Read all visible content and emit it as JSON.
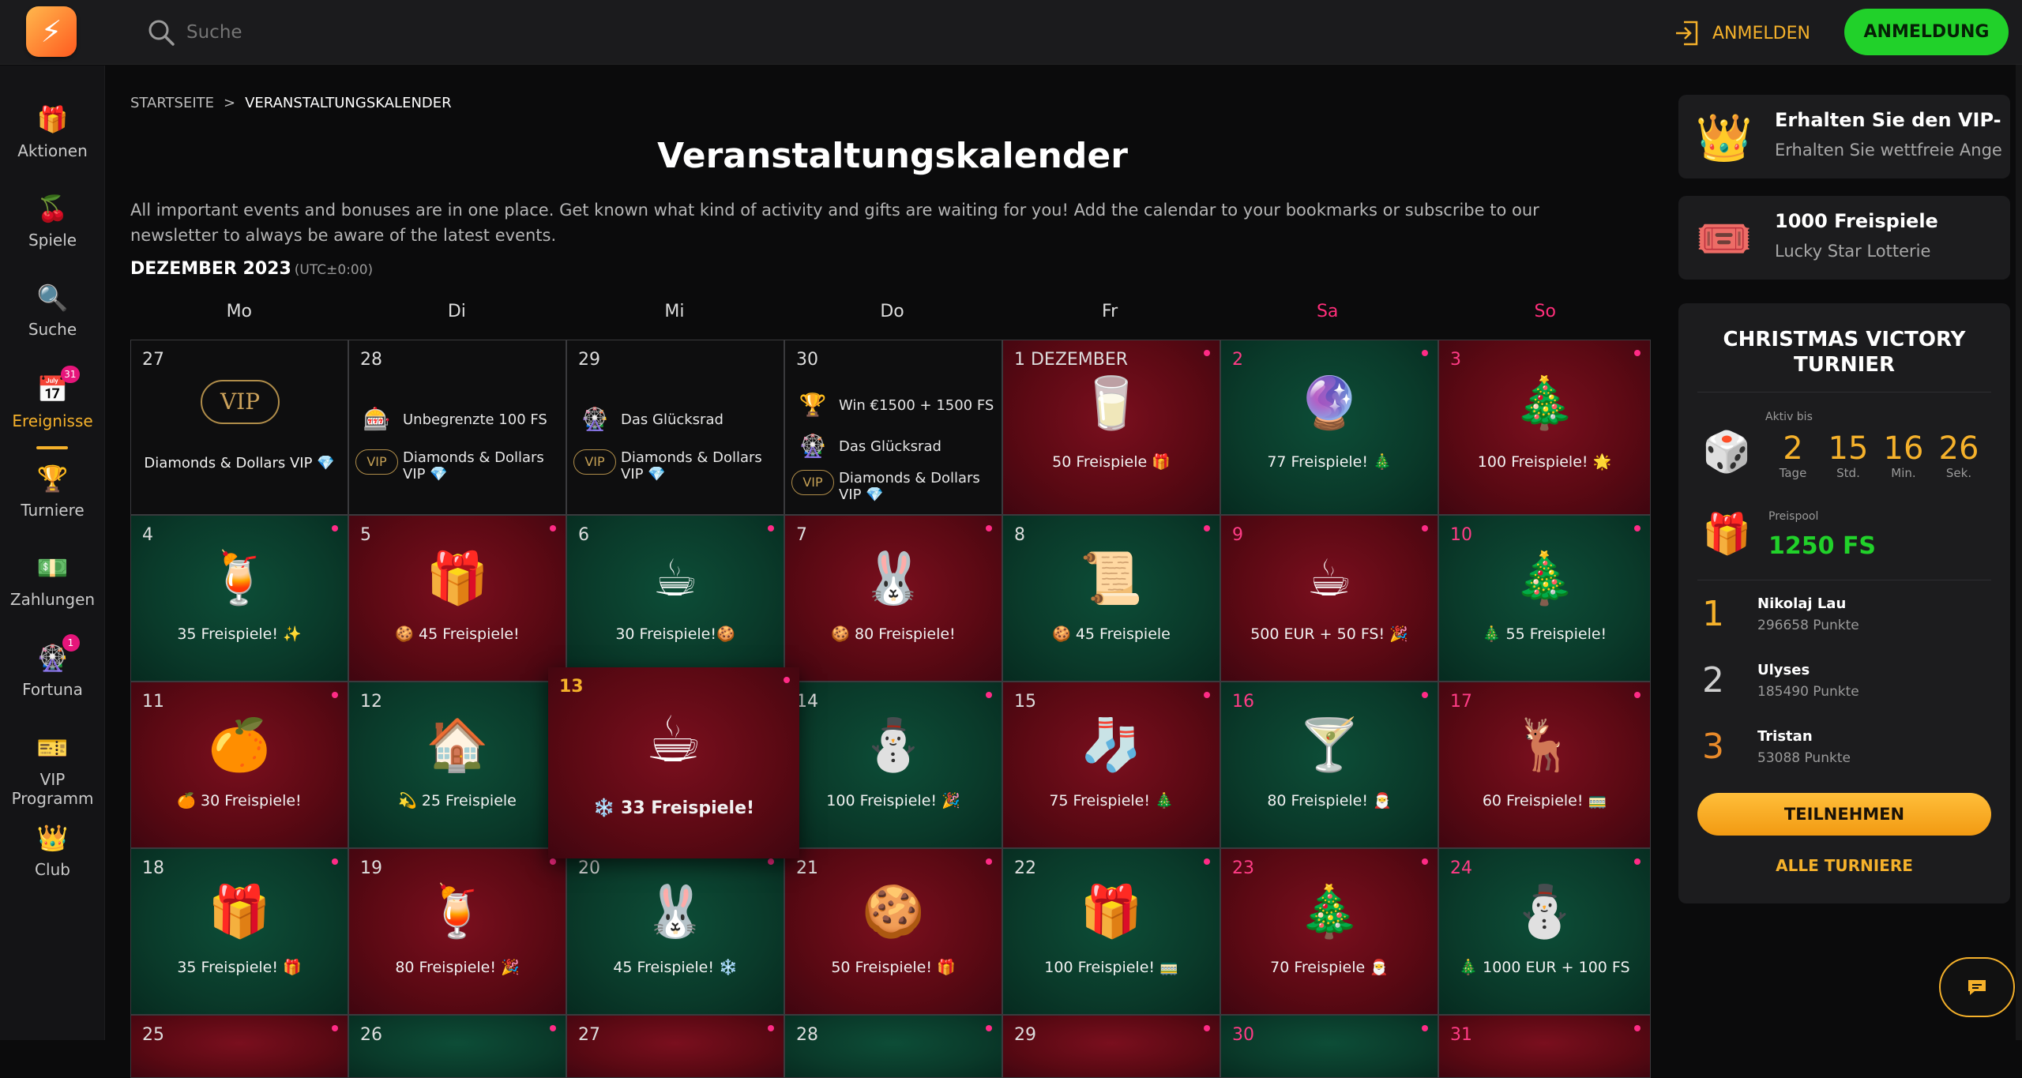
{
  "header": {
    "search_placeholder": "Suche",
    "login_label": "ANMELDEN",
    "signup_label": "ANMELDUNG",
    "logo_glyph": "⚡"
  },
  "sidebar": {
    "items": [
      {
        "label": "Aktionen",
        "icon": "🎁"
      },
      {
        "label": "Spiele",
        "icon": "🍒"
      },
      {
        "label": "Suche",
        "icon": "🔍"
      },
      {
        "label": "Ereignisse",
        "icon": "📅",
        "badge": "31"
      },
      {
        "label": "Turniere",
        "icon": "🏆"
      },
      {
        "label": "Zahlungen",
        "icon": "💵"
      },
      {
        "label": "Fortuna",
        "icon": "🎡",
        "badge": "1"
      },
      {
        "label": "VIP Programm",
        "icon": "🎫"
      },
      {
        "label": "Club",
        "icon": "👑"
      }
    ]
  },
  "breadcrumb": {
    "home": "STARTSEITE",
    "sep": ">",
    "current": "VERANSTALTUNGSKALENDER"
  },
  "page": {
    "title": "Veranstaltungskalender",
    "intro": "All important events and bonuses are in one place. Get known what kind of activity and gifts are waiting for you! Add the calendar to your bookmarks or subscribe to our newsletter to always be aware of the latest events.",
    "month": "DEZEMBER 2023",
    "tz": "(UTC±0:00)"
  },
  "weekdays": [
    "Mo",
    "Di",
    "Mi",
    "Do",
    "Fr",
    "Sa",
    "So"
  ],
  "past_cells": {
    "c27": {
      "num": "27",
      "icon": "VIP",
      "label": "Diamonds & Dollars VIP 💎"
    },
    "c28": {
      "num": "28",
      "rows": [
        {
          "icon": "🎰",
          "text": "Unbegrenzte 100 FS"
        },
        {
          "icon": "VIP",
          "text": "Diamonds & Dollars VIP 💎"
        }
      ]
    },
    "c29": {
      "num": "29",
      "rows": [
        {
          "icon": "🎡",
          "text": "Das Glücksrad"
        },
        {
          "icon": "VIP",
          "text": "Diamonds & Dollars VIP 💎"
        }
      ]
    },
    "c30": {
      "num": "30",
      "rows": [
        {
          "icon": "🏆",
          "text": "Win €1500 + 1500 FS"
        },
        {
          "icon": "🎡",
          "text": "Das Glücksrad"
        },
        {
          "icon": "VIP",
          "text": "Diamonds & Dollars VIP 💎"
        }
      ]
    }
  },
  "days": [
    {
      "num": "1 DEZEMBER",
      "label": "50 Freispiele 🎁",
      "art": "🥛"
    },
    {
      "num": "2",
      "label": "77 Freispiele! 🎄",
      "art": "🔮"
    },
    {
      "num": "3",
      "label": "100 Freispiele! 🌟",
      "art": "🎄"
    },
    {
      "num": "4",
      "label": "35 Freispiele! ✨",
      "art": "🍹"
    },
    {
      "num": "5",
      "label": "🍪 45 Freispiele!",
      "art": "🎁"
    },
    {
      "num": "6",
      "label": "30 Freispiele!🍪",
      "art": "☕"
    },
    {
      "num": "7",
      "label": "🍪 80 Freispiele!",
      "art": "🐰"
    },
    {
      "num": "8",
      "label": "🍪 45 Freispiele",
      "art": "📜"
    },
    {
      "num": "9",
      "label": "500 EUR + 50 FS! 🎉",
      "art": "☕"
    },
    {
      "num": "10",
      "label": "🎄 55 Freispiele!",
      "art": "🎄"
    },
    {
      "num": "11",
      "label": "🍊 30 Freispiele!",
      "art": "🍊"
    },
    {
      "num": "12",
      "label": "💫 25 Freispiele",
      "art": "🏠"
    },
    {
      "num": "13",
      "label": "❄️ 33 Freispiele!",
      "art": "☕"
    },
    {
      "num": "14",
      "label": "100 Freispiele! 🎉",
      "art": "⛄"
    },
    {
      "num": "15",
      "label": "75 Freispiele! 🎄",
      "art": "🧦"
    },
    {
      "num": "16",
      "label": "80 Freispiele! 🎅",
      "art": "🍸"
    },
    {
      "num": "17",
      "label": "60 Freispiele! 🚃",
      "art": "🦌"
    },
    {
      "num": "18",
      "label": "35 Freispiele! 🎁",
      "art": "🎁"
    },
    {
      "num": "19",
      "label": "80 Freispiele! 🎉",
      "art": "🍹"
    },
    {
      "num": "20",
      "label": "45 Freispiele! ❄️",
      "art": "🐰"
    },
    {
      "num": "21",
      "label": "50 Freispiele! 🎁",
      "art": "🍪"
    },
    {
      "num": "22",
      "label": "100 Freispiele! 🚃",
      "art": "🎁"
    },
    {
      "num": "23",
      "label": "70 Freispiele 🎅",
      "art": "🎄"
    },
    {
      "num": "24",
      "label": "🎄 1000 EUR + 100 FS",
      "art": "⛄"
    },
    {
      "num": "25",
      "label": "",
      "art": ""
    },
    {
      "num": "26",
      "label": "",
      "art": ""
    },
    {
      "num": "27",
      "label": "",
      "art": ""
    },
    {
      "num": "28",
      "label": "",
      "art": ""
    },
    {
      "num": "29",
      "label": "",
      "art": ""
    },
    {
      "num": "30",
      "label": "",
      "art": ""
    },
    {
      "num": "31",
      "label": "",
      "art": ""
    }
  ],
  "promos": [
    {
      "title": "Erhalten Sie den VIP-S...",
      "subtitle": "Erhalten Sie wettfreie Angeb...",
      "icon": "👑"
    },
    {
      "title": "1000 Freispiele",
      "subtitle": "Lucky Star Lotterie",
      "icon": "🎟️"
    }
  ],
  "tournament": {
    "title_line1": "CHRISTMAS VICTORY",
    "title_line2": "TURNIER",
    "active_label": "Aktiv bis",
    "countdown": [
      {
        "value": "2",
        "unit": "Tage"
      },
      {
        "value": "15",
        "unit": "Std."
      },
      {
        "value": "16",
        "unit": "Min."
      },
      {
        "value": "26",
        "unit": "Sek."
      }
    ],
    "pool_label": "Preispool",
    "pool_value": "1250 FS",
    "leaders": [
      {
        "pos": "1",
        "name": "Nikolaj Lau",
        "points": "296658 Punkte",
        "color": "#f5b12b"
      },
      {
        "pos": "2",
        "name": "Ulyses",
        "points": "185490 Punkte",
        "color": "#cfcfcf"
      },
      {
        "pos": "3",
        "name": "Tristan",
        "points": "53088 Punkte",
        "color": "#e88a2a"
      }
    ],
    "join_label": "TEILNEHMEN",
    "all_label": "ALLE TURNIERE"
  },
  "colors": {
    "accent": "#f5b12b",
    "signup": "#21d12a",
    "weekend": "#ff2e7a"
  }
}
